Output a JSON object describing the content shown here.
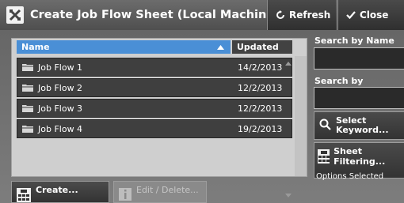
{
  "header": {
    "title": "Create Job Flow Sheet (Local Machine)",
    "refresh_label": "Refresh",
    "close_label": "Close"
  },
  "list": {
    "columns": {
      "name": "Name",
      "updated": "Updated"
    },
    "rows": [
      {
        "name": "Job Flow 1",
        "updated": "14/2/2013"
      },
      {
        "name": "Job Flow 2",
        "updated": "12/2/2013"
      },
      {
        "name": "Job Flow 3",
        "updated": "12/2/2013"
      },
      {
        "name": "Job Flow 4",
        "updated": "19/2/2013"
      }
    ]
  },
  "sidebar": {
    "search_name_label": "Search by Name",
    "search_keyword_label": "Search by Keyword",
    "select_keyword_line1": "Select",
    "select_keyword_line2": "Keyword...",
    "sheet_filtering_label": "Sheet Filtering...",
    "options_selected_label": "Options Selected"
  },
  "footer": {
    "create_label": "Create...",
    "edit_delete_label": "Edit / Delete..."
  },
  "colors": {
    "header_selected": "#4a8fd6",
    "row_bg": "#3f3f3f",
    "title_bar": "#5c5c5c"
  },
  "icons": {
    "title": "job-flow-x-icon",
    "refresh": "refresh-icon",
    "close": "checkmark-icon",
    "folder": "folder-icon",
    "search": "magnifier-icon",
    "sheet": "sheet-grid-icon",
    "info": "info-icon"
  }
}
